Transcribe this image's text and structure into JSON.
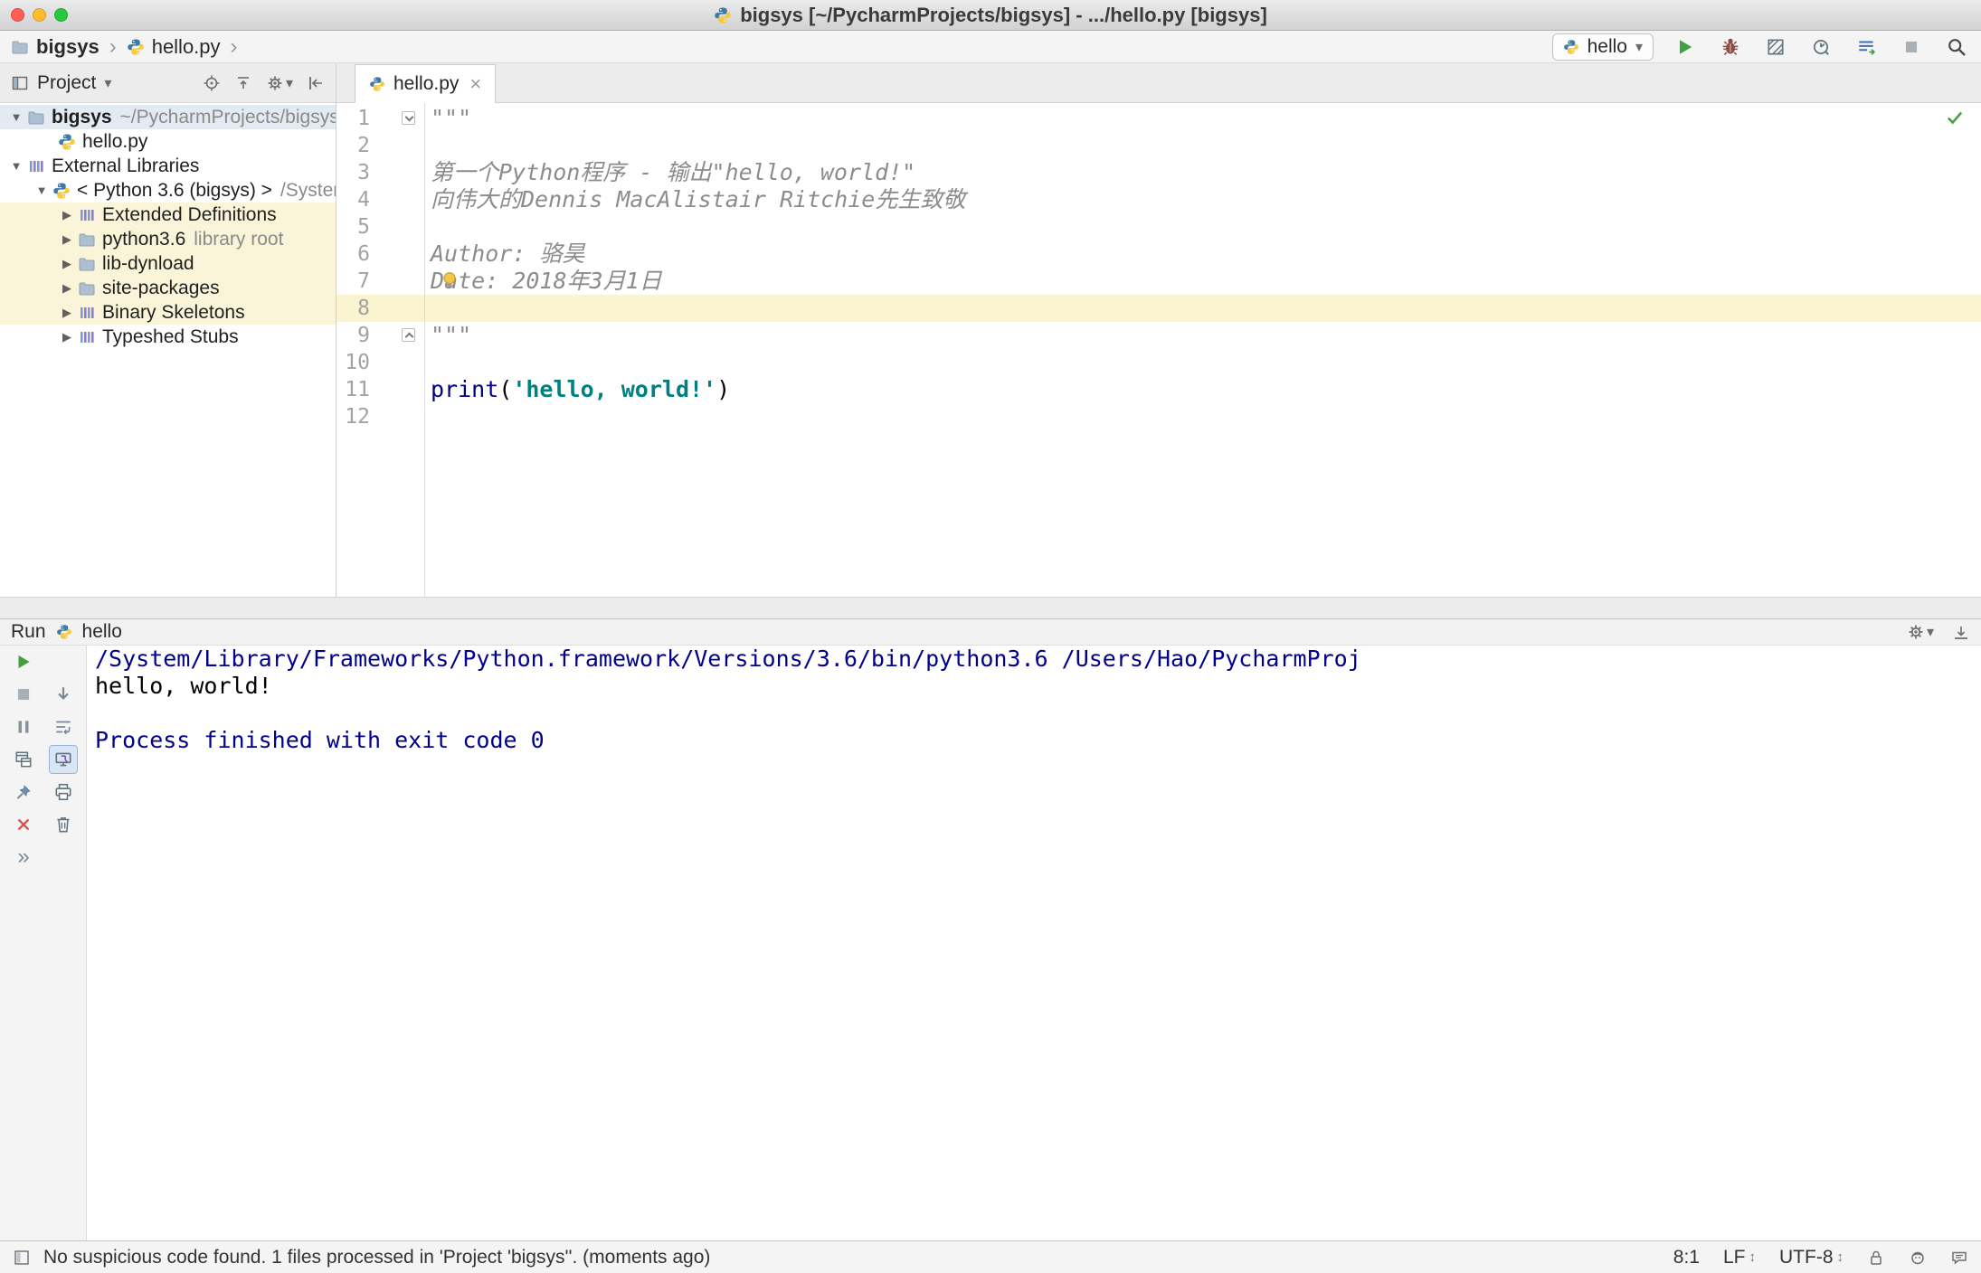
{
  "titlebar": {
    "title": "bigsys [~/PycharmProjects/bigsys] - .../hello.py [bigsys]"
  },
  "toolbar": {
    "breadcrumb": {
      "project": "bigsys",
      "file": "hello.py"
    },
    "run_config": "hello"
  },
  "glyphs": {
    "tree_expanded": "▼",
    "tree_collapsed": "▶",
    "dropdown_arrow": "▾",
    "breadcrumb_separator": "›",
    "tab_close": "×",
    "updown_arrows": "↕",
    "more_chevron": "»"
  },
  "project": {
    "header": "Project",
    "tree": [
      {
        "label": "bigsys",
        "suffix": "~/PycharmProjects/bigsys"
      },
      {
        "label": "hello.py"
      },
      {
        "label": "External Libraries"
      },
      {
        "label": "< Python 3.6 (bigsys) >",
        "suffix": "/System"
      },
      {
        "label": "Extended Definitions"
      },
      {
        "label": "python3.6",
        "suffix": "library root"
      },
      {
        "label": "lib-dynload"
      },
      {
        "label": "site-packages"
      },
      {
        "label": "Binary Skeletons"
      },
      {
        "label": "Typeshed Stubs"
      }
    ]
  },
  "editor": {
    "tab": "hello.py",
    "line_numbers": [
      "1",
      "2",
      "3",
      "4",
      "5",
      "6",
      "7",
      "8",
      "9",
      "10",
      "11",
      "12"
    ],
    "doc": {
      "open": "\"\"\"",
      "l3": "第一个Python程序 - 输出\"hello, world!\"",
      "l4": "向伟大的Dennis MacAlistair Ritchie先生致敬",
      "l6": "Author: 骆昊",
      "l7": "Date: 2018年3月1日",
      "close": "\"\"\""
    },
    "code": {
      "fn": "print",
      "paren_open": "(",
      "string": "'hello, world!'",
      "paren_close": ")"
    }
  },
  "run": {
    "title": "Run",
    "config": "hello",
    "console": {
      "line1": "/System/Library/Frameworks/Python.framework/Versions/3.6/bin/python3.6 /Users/Hao/PycharmProj",
      "line2": "hello, world!",
      "line4": "Process finished with exit code 0"
    }
  },
  "statusbar": {
    "message": "No suspicious code found. 1 files processed in 'Project 'bigsys''. (moments ago)",
    "caret": "8:1",
    "line_sep": "LF",
    "encoding": "UTF-8"
  },
  "colors": {
    "run_green": "#3fa142",
    "close_red": "#d15757",
    "string_teal": "#008080",
    "keyword_blue": "#000080",
    "console_system_blue": "#00008b",
    "tree_scope_yellow": "#faf4d8",
    "caret_row_yellow": "#fbf4d0"
  }
}
